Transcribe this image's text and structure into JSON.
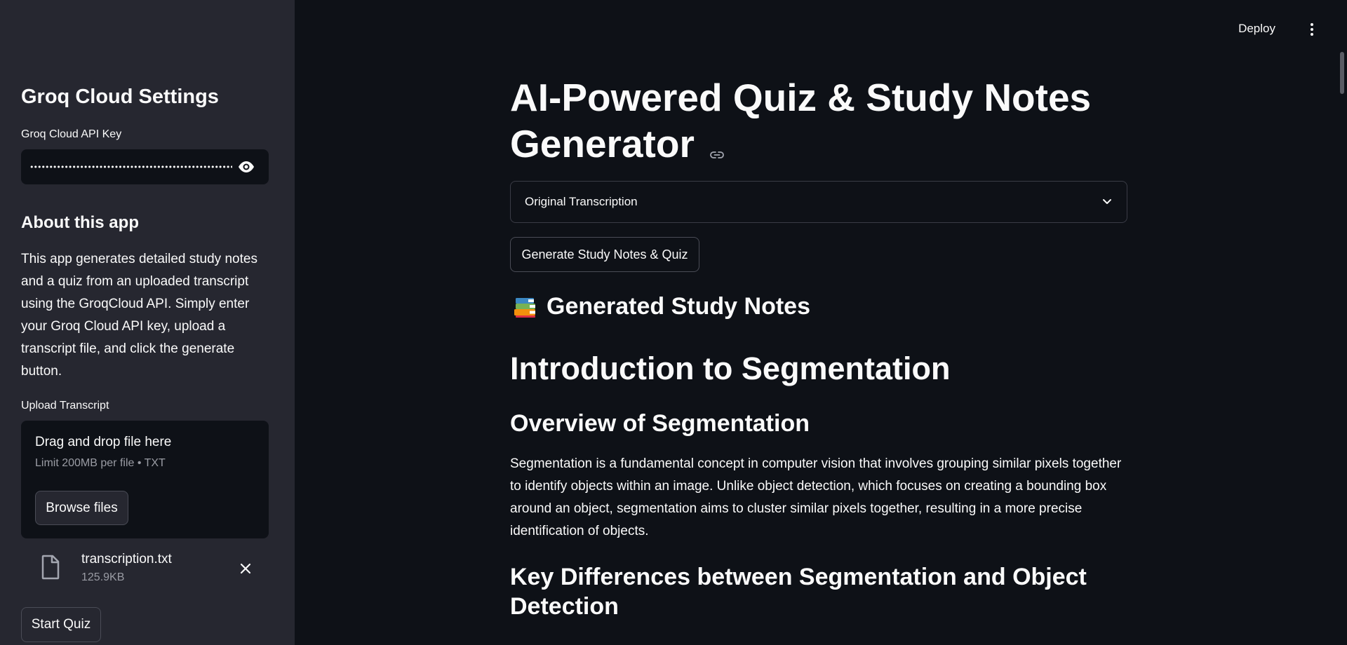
{
  "sidebar": {
    "settings_title": "Groq Cloud Settings",
    "api_key_label": "Groq Cloud API Key",
    "api_key_masked": "••••••••••••••••••••••••••••••••••••••••••••••••••••••••••••••••••",
    "about_title": "About this app",
    "about_text": "This app generates detailed study notes and a quiz from an uploaded transcript using the GroqCloud API. Simply enter your Groq Cloud API key, upload a transcript file, and click the generate button.",
    "upload_label": "Upload Transcript",
    "upload": {
      "drag_text": "Drag and drop file here",
      "limit_text": "Limit 200MB per file • TXT",
      "browse_label": "Browse files"
    },
    "file": {
      "name": "transcription.txt",
      "size": "125.9KB"
    },
    "start_quiz_label": "Start Quiz"
  },
  "header": {
    "deploy_label": "Deploy"
  },
  "main": {
    "title": "AI-Powered Quiz & Study Notes Generator",
    "expander_label": "Original Transcription",
    "generate_label": "Generate Study Notes & Quiz",
    "notes_heading": "Generated Study Notes",
    "h1": "Introduction to Segmentation",
    "h2_overview": "Overview of Segmentation",
    "overview_text": "Segmentation is a fundamental concept in computer vision that involves grouping similar pixels together to identify objects within an image. Unlike object detection, which focuses on creating a bounding box around an object, segmentation aims to cluster similar pixels together, resulting in a more precise identification of objects.",
    "h2_differences": "Key Differences between Segmentation and Object Detection"
  },
  "colors": {
    "sidebar_bg": "#262730",
    "main_bg": "#0e1117",
    "text": "#fafafa",
    "muted": "#9a9ca4"
  }
}
